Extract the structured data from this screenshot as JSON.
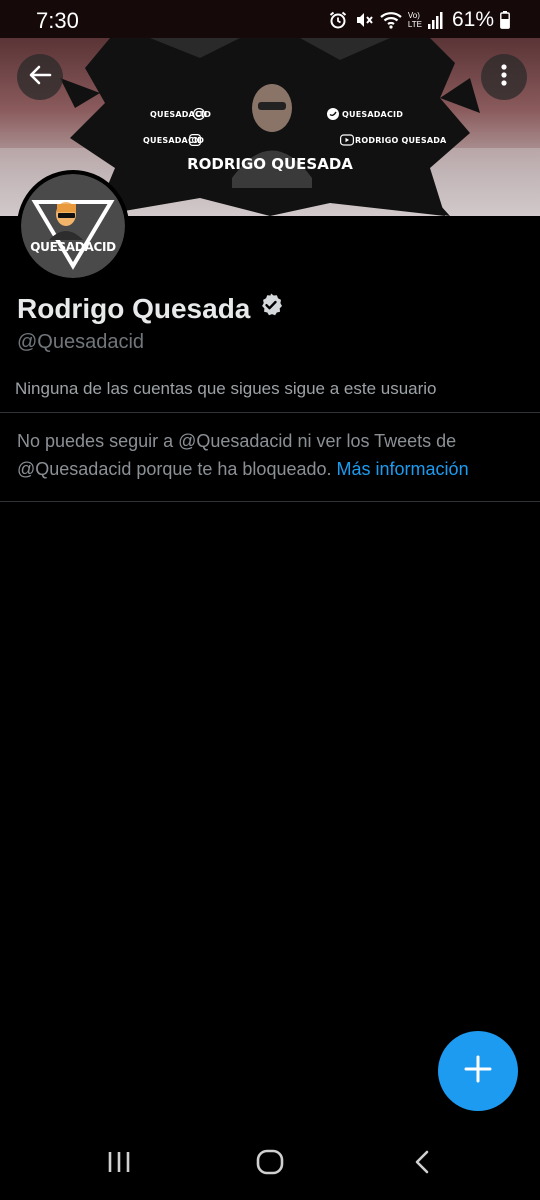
{
  "status_bar": {
    "time": "7:30",
    "network_label_top": "Vo)",
    "network_label_bottom": "LTE",
    "battery_percent": "61%",
    "icons": [
      "alarm-icon",
      "mute-icon",
      "wifi-icon",
      "signal-icon",
      "battery-icon"
    ]
  },
  "banner": {
    "title": "RODRIGO QUESADA",
    "social_labels": [
      "QUESADACID",
      "QUESADACID",
      "QUESADACID",
      "RODRIGO QUESADA"
    ],
    "social_icons": [
      "twitch-icon",
      "twitter-icon",
      "instagram-icon",
      "youtube-icon"
    ]
  },
  "header_actions": {
    "back_icon": "arrow-left-icon",
    "more_icon": "more-vertical-icon"
  },
  "profile": {
    "avatar_text": "QUESADACID",
    "display_name": "Rodrigo Quesada",
    "verified_icon": "verified-badge-icon",
    "handle": "@Quesadacid",
    "followers_you_know": "Ninguna de las cuentas que sigues sigue a este usuario"
  },
  "blocked_notice": {
    "text": "No puedes seguir a @Quesadacid ni ver los Tweets de @Quesadacid porque te ha bloqueado.",
    "link": "Más información"
  },
  "fab": {
    "icon": "plus-icon"
  },
  "nav_bar": {
    "icons": [
      "recents-icon",
      "home-icon",
      "back-icon"
    ]
  },
  "colors": {
    "accent": "#1d9bf0",
    "background": "#000000",
    "muted_text": "#71767b",
    "divider": "#2f3336"
  }
}
